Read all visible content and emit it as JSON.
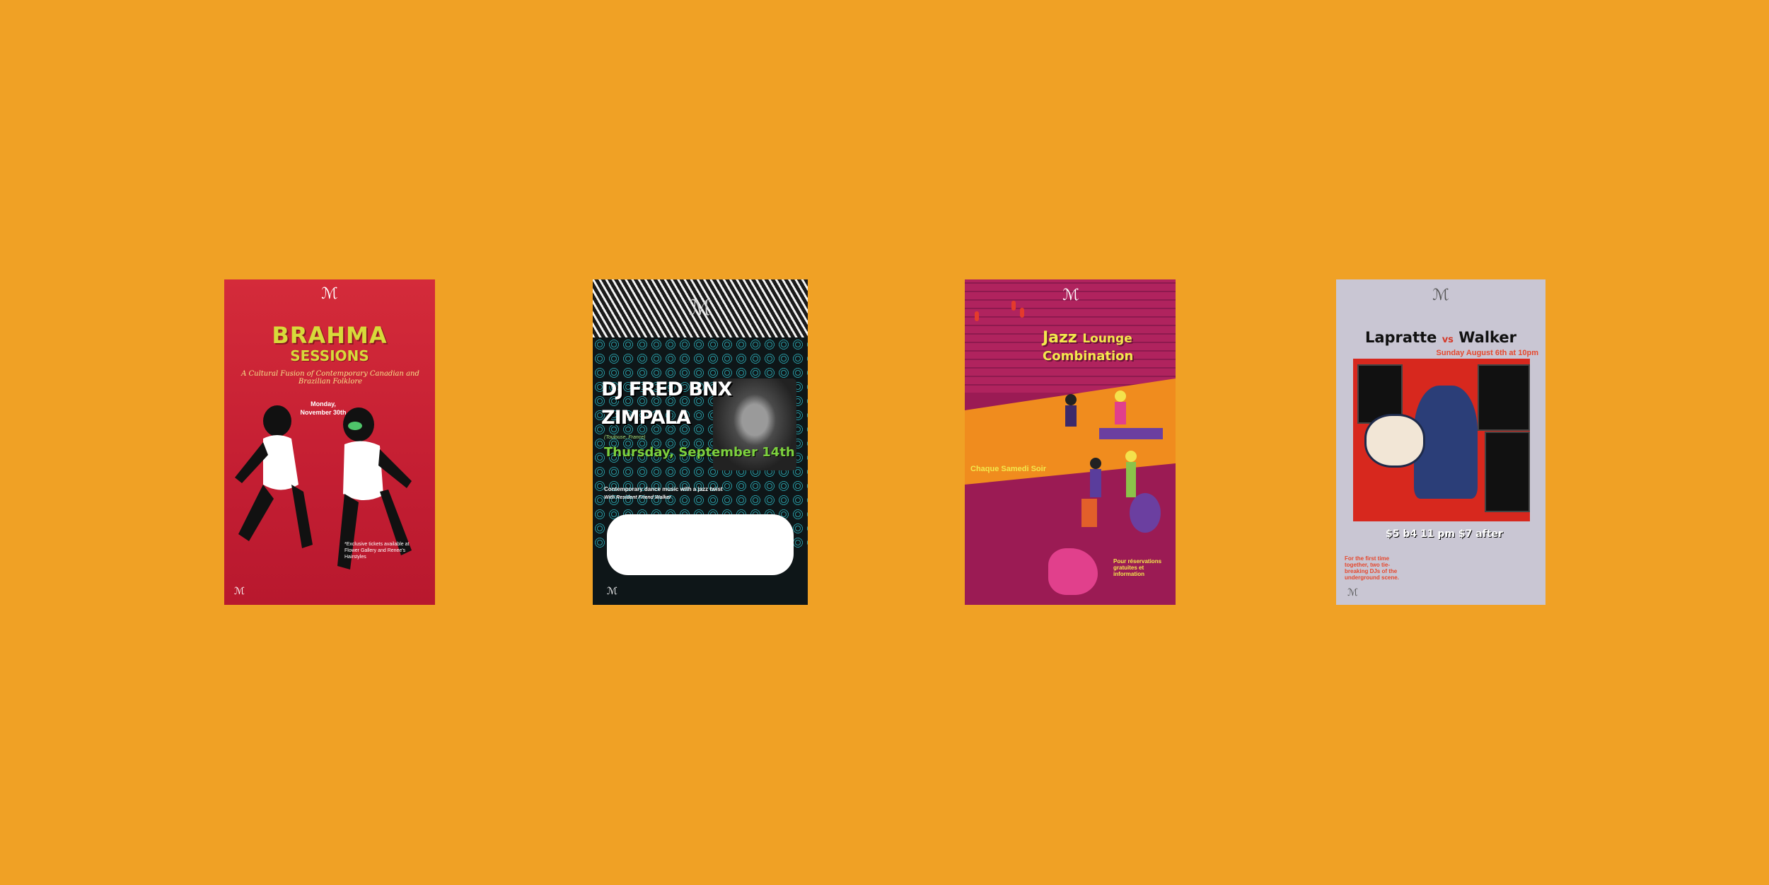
{
  "background_color": "#F0A125",
  "posters": [
    {
      "name": "brahma-sessions",
      "title": "BRAHMA",
      "subtitle_line": "SESSIONS",
      "tagline": "A Cultural Fusion of Contemporary Canadian and Brazilian Folklore",
      "date_line": "Monday, November 30th",
      "closing": "*Exclusive tickets available at Flower Gallery and Renee's Hairstyles"
    },
    {
      "name": "dj-fred-bnx",
      "headliner": "DJ FRED BNX",
      "act": "ZIMPALA",
      "location": "(Toulouse, France)",
      "date": "Thursday, September 14th",
      "tagline": "Contemporary dance music with a jazz twist",
      "resident": "With Resident Friend Walker"
    },
    {
      "name": "jazz-lounge-combination",
      "title_word1": "Jazz",
      "title_word2": "Lounge",
      "title_line2": "Combination",
      "host": "Chaque Samedi Soir",
      "info": "Pour réservations gratuites et information"
    },
    {
      "name": "lapratte-vs-walker",
      "fighter1": "Lapratte",
      "vs": "vs",
      "fighter2": "Walker",
      "date": "Sunday August 6th at 10pm",
      "price": "$5 b4 11 pm $7 after",
      "blurb": "For the first time together, two tie-breaking DJs of the underground scene."
    }
  ]
}
